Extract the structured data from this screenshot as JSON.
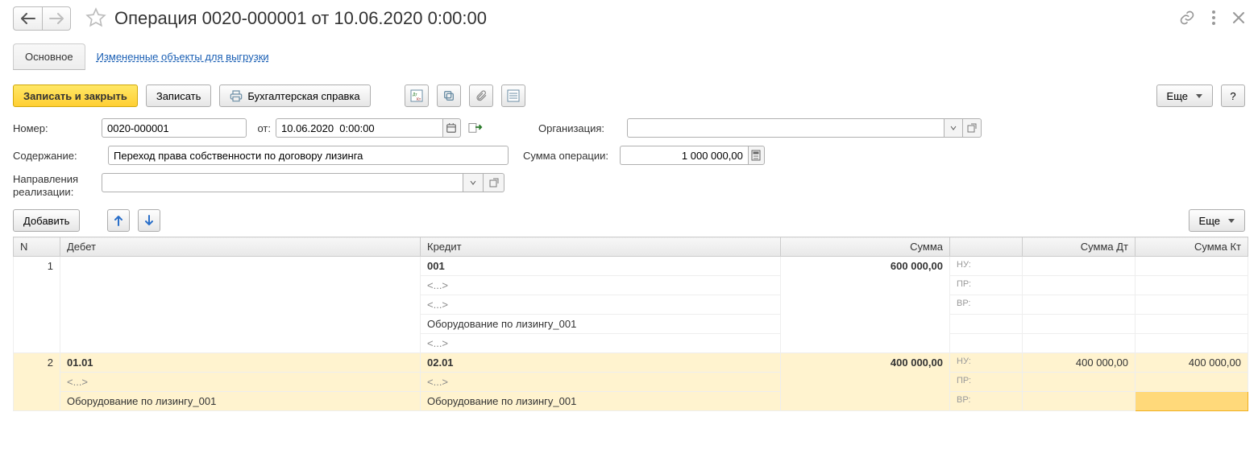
{
  "header": {
    "title": "Операция 0020-000001 от 10.06.2020 0:00:00"
  },
  "tabs": {
    "main": "Основное",
    "changed": "Измененные объекты для выгрузки"
  },
  "toolbar": {
    "save_close": "Записать и закрыть",
    "save": "Записать",
    "accounting_note": "Бухгалтерская справка",
    "more": "Еще",
    "help": "?"
  },
  "form": {
    "number_label": "Номер:",
    "number_value": "0020-000001",
    "date_label": "от:",
    "date_value": "10.06.2020  0:00:00",
    "org_label": "Организация:",
    "org_value": "",
    "content_label": "Содержание:",
    "content_value": "Переход права собственности по договору лизинга",
    "sum_label": "Сумма операции:",
    "sum_value": "1 000 000,00",
    "dir_label": "Направления реализации:",
    "dir_value": ""
  },
  "toolbar2": {
    "add": "Добавить",
    "more": "Еще"
  },
  "table": {
    "headers": {
      "n": "N",
      "debit": "Дебет",
      "credit": "Кредит",
      "sum": "Сумма",
      "mini": "",
      "sum_dt": "Сумма Дт",
      "sum_kt": "Сумма Кт"
    },
    "mini_labels": {
      "nu": "НУ:",
      "pr": "ПР:",
      "vr": "ВР:"
    },
    "rows": [
      {
        "n": "1",
        "debit": {
          "account": "",
          "lines": []
        },
        "credit": {
          "account": "001",
          "lines": [
            "<...>",
            "<...>",
            "Оборудование по лизингу_001",
            "<...>"
          ]
        },
        "sum": "600 000,00",
        "sum_dt": "",
        "sum_kt": ""
      },
      {
        "n": "2",
        "debit": {
          "account": "01.01",
          "lines": [
            "<...>",
            "Оборудование по лизингу_001"
          ]
        },
        "credit": {
          "account": "02.01",
          "lines": [
            "<...>",
            "Оборудование по лизингу_001"
          ]
        },
        "sum": "400 000,00",
        "sum_dt": "400 000,00",
        "sum_kt": "400 000,00"
      }
    ]
  }
}
